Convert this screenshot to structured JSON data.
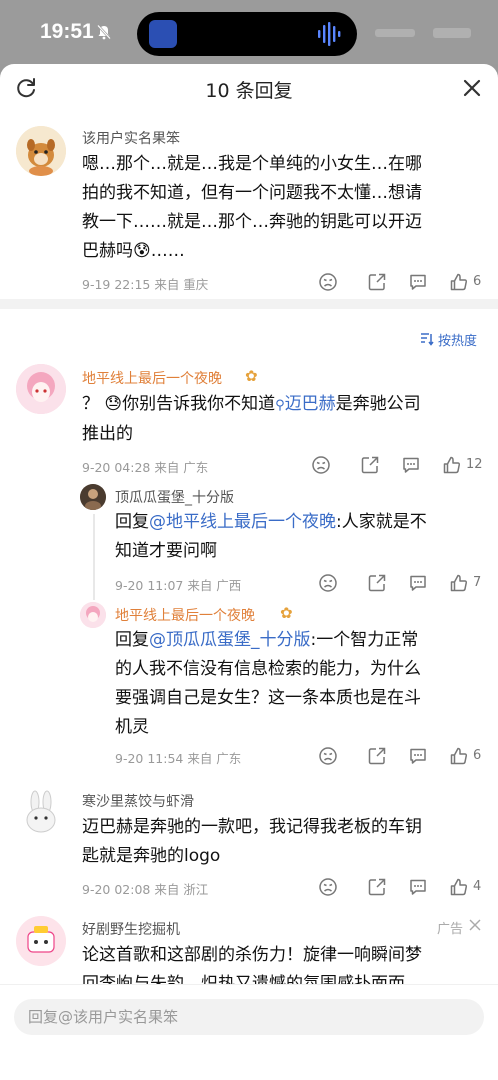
{
  "status_bar": {
    "time": "19:51"
  },
  "header": {
    "title": "10 条回复"
  },
  "root_comment": {
    "author": "该用户实名果笨",
    "lines": [
      "嗯…那个…就是…我是个单纯的小女生…在哪",
      "拍的我不知道，但有一个问题我不太懂…想请",
      "教一下……就是…那个…奔驰的钥匙可以开迈",
      "巴赫吗😰……"
    ],
    "meta": "9-19 22:15  来自 重庆",
    "likes": "6"
  },
  "sort_label": "按热度",
  "comments": [
    {
      "author": "地平线上最后一个夜晚",
      "line1_prefix": "？ 😓你别告诉我你不知道",
      "line1_link": "迈巴赫",
      "line1_suffix": "是奔驰公司",
      "line2": "推出的",
      "meta": "9-20 04:28  来自 广东",
      "likes": "12"
    },
    {
      "author": "顶瓜瓜蛋堡_十分版",
      "reply_word": "回复",
      "mention": "@地平线上最后一个夜晚",
      "line1_suffix": ":人家就是不",
      "line2": "知道才要问啊",
      "meta": "9-20 11:07  来自 广西",
      "likes": "7"
    },
    {
      "author": "地平线上最后一个夜晚",
      "reply_word": "回复",
      "mention": "@顶瓜瓜蛋堡_十分版",
      "line1_suffix": ":一个智力正常",
      "line2": "的人我不信没有信息检索的能力，为什么",
      "line3": "要强调自己是女生？这一条本质也是在斗",
      "line4": "机灵",
      "meta": "9-20 11:54  来自 广东",
      "likes": "6"
    },
    {
      "author": "寒沙里蒸饺与虾滑",
      "line1": "迈巴赫是奔驰的一款吧，我记得我老板的车钥",
      "line2": "匙就是奔驰的logo",
      "meta": "9-20 02:08  来自 浙江",
      "likes": "4"
    },
    {
      "author": "好剧野生挖掘机",
      "ad_label": "广告",
      "line1": "论这首歌和这部剧的杀伤力！旋律一响瞬间梦",
      "line2": "回李峋与朱韵，炽热又遗憾的氛围感扑面而"
    }
  ],
  "reply_box": {
    "placeholder": "回复@该用户实名果笨"
  },
  "icons": [
    "refresh-icon",
    "close-icon",
    "dislike-icon",
    "share-icon",
    "comment-icon",
    "like-icon",
    "sort-icon"
  ]
}
